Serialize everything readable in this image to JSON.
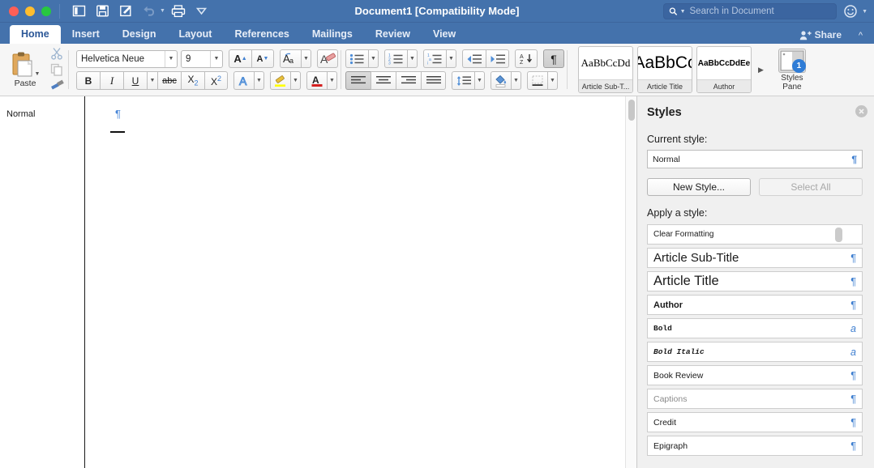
{
  "window": {
    "title": "Document1 [Compatibility Mode]",
    "traffic_lights": [
      "close",
      "minimize",
      "maximize"
    ],
    "accent_titlebar": "#4472ac",
    "quick_access": [
      {
        "name": "sidebar-toggle-icon",
        "label": "Sidebar"
      },
      {
        "name": "save-icon",
        "label": "Save"
      },
      {
        "name": "track-changes-icon",
        "label": "Track Changes"
      },
      {
        "name": "undo-icon",
        "label": "Undo"
      },
      {
        "name": "print-icon",
        "label": "Print"
      },
      {
        "name": "customize-toolbar-icon",
        "label": "Customize Toolbar"
      }
    ]
  },
  "search": {
    "placeholder": "Search in Document",
    "value": "",
    "icon": "search-icon"
  },
  "help": {
    "icon": "smiley-icon",
    "label": "Tell me"
  },
  "tabs": [
    {
      "label": "Home",
      "active": true
    },
    {
      "label": "Insert",
      "active": false
    },
    {
      "label": "Design",
      "active": false
    },
    {
      "label": "Layout",
      "active": false
    },
    {
      "label": "References",
      "active": false
    },
    {
      "label": "Mailings",
      "active": false
    },
    {
      "label": "Review",
      "active": false
    },
    {
      "label": "View",
      "active": false
    }
  ],
  "share": {
    "label": "Share",
    "icon": "add-person-icon"
  },
  "ribbon_collapse": {
    "label": "^",
    "icon": "chevron-up-icon"
  },
  "ribbon": {
    "clipboard": {
      "paste_label": "Paste",
      "cut_label": "Cut",
      "copy_label": "Copy",
      "format_painter_label": "Format Painter"
    },
    "font": {
      "name": "Helvetica Neue",
      "size": "9",
      "grow_label": "A",
      "shrink_label": "A",
      "change_case_label": "Aa",
      "clear_formatting_label": "A",
      "bold_label": "B",
      "italic_label": "I",
      "underline_label": "U",
      "strikethrough_label": "abc",
      "subscript_label": "X",
      "subscript_sub": "2",
      "superscript_label": "X",
      "superscript_sup": "2",
      "text_effects_label": "A",
      "highlight_label": "highlight",
      "font_color_label": "A",
      "highlight_color": "#ffff00",
      "font_color": "#d32020"
    },
    "paragraph": {
      "bullets_label": "Bullets",
      "numbering_label": "Numbering",
      "multilevel_label": "Multilevel List",
      "decrease_indent_label": "Decrease Indent",
      "increase_indent_label": "Increase Indent",
      "sort_label": "Sort",
      "show_marks_label": "¶",
      "show_marks_active": true,
      "align_left_label": "Align Left",
      "align_left_active": true,
      "align_center_label": "Center",
      "align_right_label": "Align Right",
      "justify_label": "Justify",
      "line_spacing_label": "Line Spacing",
      "shading_label": "Shading",
      "borders_label": "Borders"
    },
    "styles_gallery": [
      {
        "preview": "AaBbCcDd",
        "name": "Article Sub-T..."
      },
      {
        "preview": "AaBbCc",
        "name": "Article Title"
      },
      {
        "preview": "AaBbCcDdEe",
        "name": "Author"
      }
    ],
    "gallery_more": "▶",
    "styles_pane_button": {
      "label_line1": "Styles",
      "label_line2": "Pane",
      "badge": "1"
    }
  },
  "document": {
    "style_tag": "Normal",
    "paragraph_mark": "¶"
  },
  "scrollbar": {
    "name": "vertical-scrollbar"
  },
  "styles_pane": {
    "title": "Styles",
    "close_label": "✕",
    "current_style_label": "Current style:",
    "current_style_value": "Normal",
    "current_style_mark": "¶",
    "new_style_label": "New Style...",
    "select_all_label": "Select All",
    "select_all_enabled": false,
    "apply_style_label": "Apply a style:",
    "style_list": [
      {
        "name": "Clear Formatting",
        "mark": "",
        "font": "small",
        "muted": false
      },
      {
        "name": "Article Sub-Title",
        "mark": "¶",
        "font": "large",
        "muted": false
      },
      {
        "name": "Article Title",
        "mark": "¶",
        "font": "xlarge",
        "muted": false
      },
      {
        "name": "Author",
        "mark": "¶",
        "font": "bold",
        "muted": false
      },
      {
        "name": "Bold",
        "mark": "a",
        "font": "mono-bold",
        "muted": false
      },
      {
        "name": "Bold Italic",
        "mark": "a",
        "font": "mono-bold-italic",
        "muted": false
      },
      {
        "name": "Book Review",
        "mark": "¶",
        "font": "small",
        "muted": false
      },
      {
        "name": "Captions",
        "mark": "¶",
        "font": "small",
        "muted": true
      },
      {
        "name": "Credit",
        "mark": "¶",
        "font": "small",
        "muted": false
      },
      {
        "name": "Epigraph",
        "mark": "¶",
        "font": "small",
        "muted": false
      }
    ]
  }
}
